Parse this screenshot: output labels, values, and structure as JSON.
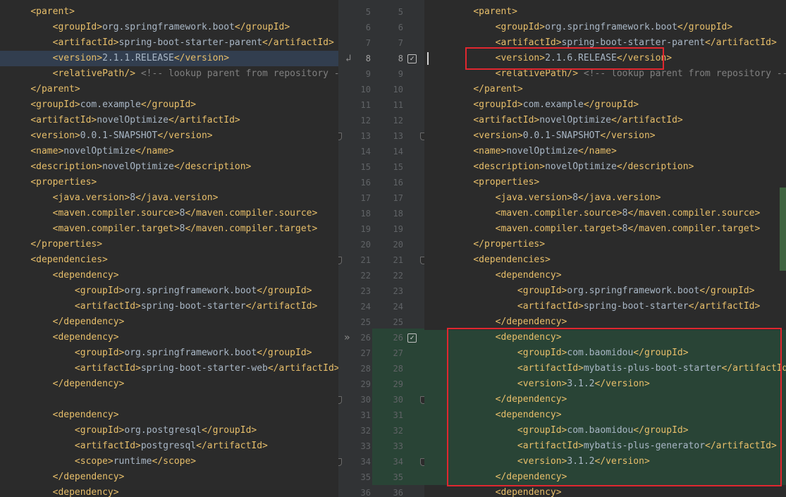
{
  "left": {
    "lines": [
      {
        "i": 1,
        "code": "<parent>"
      },
      {
        "i": 2,
        "code": "<groupId>org.springframework.boot</groupId>"
      },
      {
        "i": 2,
        "code": "<artifactId>spring-boot-starter-parent</artifactId>"
      },
      {
        "i": 2,
        "code": "<version>2.1.1.RELEASE</version>",
        "cls": "hl-current"
      },
      {
        "i": 2,
        "code": "<relativePath/> <!-- lookup parent from repository -->"
      },
      {
        "i": 1,
        "code": "</parent>"
      },
      {
        "i": 1,
        "code": "<groupId>com.example</groupId>"
      },
      {
        "i": 1,
        "code": "<artifactId>novelOptimize</artifactId>"
      },
      {
        "i": 1,
        "code": "<version>0.0.1-SNAPSHOT</version>"
      },
      {
        "i": 1,
        "code": "<name>novelOptimize</name>"
      },
      {
        "i": 1,
        "code": "<description>novelOptimize</description>"
      },
      {
        "i": 1,
        "code": "<properties>"
      },
      {
        "i": 2,
        "code": "<java.version>8</java.version>"
      },
      {
        "i": 2,
        "code": "<maven.compiler.source>8</maven.compiler.source>"
      },
      {
        "i": 2,
        "code": "<maven.compiler.target>8</maven.compiler.target>"
      },
      {
        "i": 1,
        "code": "</properties>"
      },
      {
        "i": 1,
        "code": "<dependencies>"
      },
      {
        "i": 2,
        "code": "<dependency>"
      },
      {
        "i": 3,
        "code": "<groupId>org.springframework.boot</groupId>"
      },
      {
        "i": 3,
        "code": "<artifactId>spring-boot-starter</artifactId>"
      },
      {
        "i": 2,
        "code": "</dependency>"
      },
      {
        "i": 2,
        "code": "<dependency>"
      },
      {
        "i": 3,
        "code": "<groupId>org.springframework.boot</groupId>"
      },
      {
        "i": 3,
        "code": "<artifactId>spring-boot-starter-web</artifactId>"
      },
      {
        "i": 2,
        "code": "</dependency>"
      },
      {
        "i": 0,
        "code": ""
      },
      {
        "i": 2,
        "code": "<dependency>"
      },
      {
        "i": 3,
        "code": "<groupId>org.postgresql</groupId>"
      },
      {
        "i": 3,
        "code": "<artifactId>postgresql</artifactId>"
      },
      {
        "i": 3,
        "code": "<scope>runtime</scope>"
      },
      {
        "i": 2,
        "code": "</dependency>"
      },
      {
        "i": 2,
        "code": "<dependency>"
      }
    ]
  },
  "right": {
    "lines": [
      {
        "i": 1,
        "code": "<parent>"
      },
      {
        "i": 2,
        "code": "<groupId>org.springframework.boot</groupId>"
      },
      {
        "i": 2,
        "code": "<artifactId>spring-boot-starter-parent</artifactId>"
      },
      {
        "i": 2,
        "code": "<version>2.1.6.RELEASE</version>"
      },
      {
        "i": 2,
        "code": "<relativePath/> <!-- lookup parent from repository -->"
      },
      {
        "i": 1,
        "code": "</parent>"
      },
      {
        "i": 1,
        "code": "<groupId>com.example</groupId>"
      },
      {
        "i": 1,
        "code": "<artifactId>novelOptimize</artifactId>"
      },
      {
        "i": 1,
        "code": "<version>0.0.1-SNAPSHOT</version>"
      },
      {
        "i": 1,
        "code": "<name>novelOptimize</name>"
      },
      {
        "i": 1,
        "code": "<description>novelOptimize</description>"
      },
      {
        "i": 1,
        "code": "<properties>"
      },
      {
        "i": 2,
        "code": "<java.version>8</java.version>"
      },
      {
        "i": 2,
        "code": "<maven.compiler.source>8</maven.compiler.source>"
      },
      {
        "i": 2,
        "code": "<maven.compiler.target>8</maven.compiler.target>"
      },
      {
        "i": 1,
        "code": "</properties>"
      },
      {
        "i": 1,
        "code": "<dependencies>"
      },
      {
        "i": 2,
        "code": "<dependency>"
      },
      {
        "i": 3,
        "code": "<groupId>org.springframework.boot</groupId>"
      },
      {
        "i": 3,
        "code": "<artifactId>spring-boot-starter</artifactId>"
      },
      {
        "i": 2,
        "code": "</dependency>"
      },
      {
        "i": 2,
        "code": "<dependency>",
        "cls": "added"
      },
      {
        "i": 3,
        "code": "<groupId>com.baomidou</groupId>",
        "cls": "added"
      },
      {
        "i": 3,
        "code": "<artifactId>mybatis-plus-boot-starter</artifactId>",
        "cls": "added"
      },
      {
        "i": 3,
        "code": "<version>3.1.2</version>",
        "cls": "added"
      },
      {
        "i": 2,
        "code": "</dependency>",
        "cls": "added"
      },
      {
        "i": 2,
        "code": "<dependency>",
        "cls": "added"
      },
      {
        "i": 3,
        "code": "<groupId>com.baomidou</groupId>",
        "cls": "added"
      },
      {
        "i": 3,
        "code": "<artifactId>mybatis-plus-generator</artifactId>",
        "cls": "added"
      },
      {
        "i": 3,
        "code": "<version>3.1.2</version>",
        "cls": "added"
      },
      {
        "i": 2,
        "code": "</dependency>",
        "cls": "added"
      },
      {
        "i": 2,
        "code": "<dependency>"
      }
    ]
  },
  "gutter": {
    "left_numbers": [
      "5",
      "6",
      "7",
      "8",
      "9",
      "10",
      "11",
      "12",
      "13",
      "14",
      "15",
      "16",
      "17",
      "18",
      "19",
      "20",
      "21",
      "22",
      "23",
      "24",
      "25",
      "26",
      "27",
      "28",
      "29",
      "30",
      "31",
      "32",
      "33",
      "34",
      "35",
      "36"
    ],
    "right_numbers": [
      "5",
      "6",
      "7",
      "8",
      "9",
      "10",
      "11",
      "12",
      "13",
      "14",
      "15",
      "16",
      "17",
      "18",
      "19",
      "20",
      "21",
      "22",
      "23",
      "24",
      "25",
      "26",
      "27",
      "28",
      "29",
      "30",
      "31",
      "32",
      "33",
      "34",
      "35",
      "36"
    ]
  },
  "icons": {
    "accept_change": "check-icon",
    "apply_left": "double-chevron-right-icon",
    "revert": "revert-arrow-icon",
    "fold": "fold-marker-icon"
  },
  "colors": {
    "added_bg": "#294436",
    "annotation_red": "#e0272f",
    "tag": "#e8bf6a",
    "text": "#a9b7c6"
  }
}
